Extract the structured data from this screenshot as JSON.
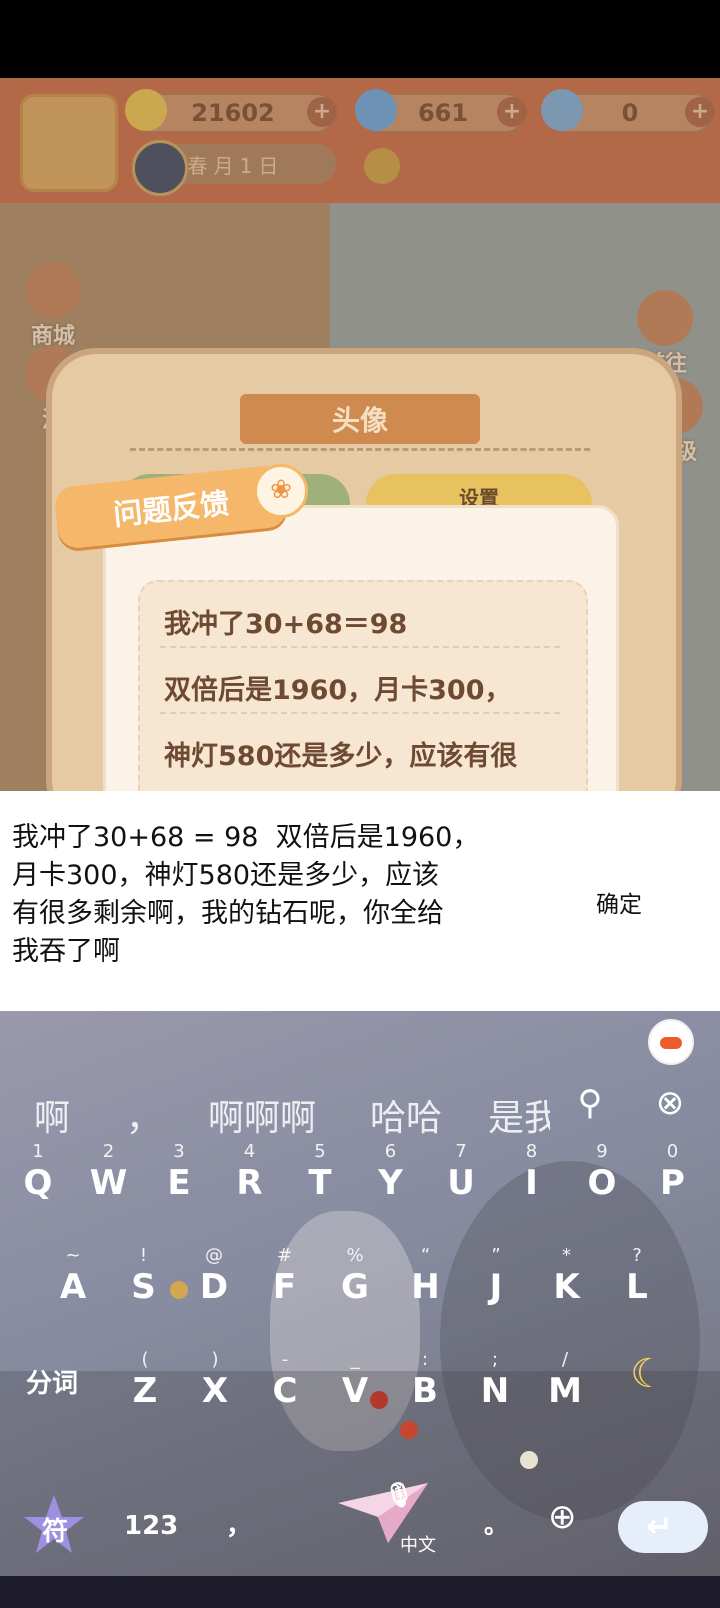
{
  "game": {
    "resources": [
      {
        "value": "21602",
        "icon": "banana-icon",
        "color": "#e8c04a"
      },
      {
        "value": "661",
        "icon": "flame-icon",
        "color": "#5aa0e6"
      },
      {
        "value": "0",
        "icon": "blue-banana-icon",
        "color": "#6ea8e0"
      }
    ],
    "date_label": "春月1日",
    "side_left": [
      "商城",
      "活"
    ],
    "side_right": [
      "前往",
      "等级"
    ],
    "panel_title": "头像",
    "tab_settings": "设置",
    "feedback_tag": "问题反馈",
    "feedback_lines": [
      "我冲了30+68＝98",
      "双倍后是1960，月卡300，",
      "神灯580还是多少，应该有很"
    ]
  },
  "edit": {
    "text": "我冲了30+68 = 98  双倍后是1960，\n月卡300，神灯580还是多少，应该\n有很多剩余啊，我的钻石呢，你全给\n我吞了啊",
    "confirm_label": "确定"
  },
  "keyboard": {
    "candidates": [
      "啊",
      "，",
      "啊啊啊",
      "哈哈",
      "是我"
    ],
    "row1": [
      {
        "num": "1",
        "ltr": "Q"
      },
      {
        "num": "2",
        "ltr": "W"
      },
      {
        "num": "3",
        "ltr": "E"
      },
      {
        "num": "4",
        "ltr": "R"
      },
      {
        "num": "5",
        "ltr": "T"
      },
      {
        "num": "6",
        "ltr": "Y"
      },
      {
        "num": "7",
        "ltr": "U"
      },
      {
        "num": "8",
        "ltr": "I"
      },
      {
        "num": "9",
        "ltr": "O"
      },
      {
        "num": "0",
        "ltr": "P"
      }
    ],
    "row2": [
      {
        "num": "~",
        "ltr": "A"
      },
      {
        "num": "!",
        "ltr": "S"
      },
      {
        "num": "@",
        "ltr": "D"
      },
      {
        "num": "#",
        "ltr": "F"
      },
      {
        "num": "%",
        "ltr": "G"
      },
      {
        "num": "“",
        "ltr": "H"
      },
      {
        "num": "”",
        "ltr": "J"
      },
      {
        "num": "*",
        "ltr": "K"
      },
      {
        "num": "?",
        "ltr": "L"
      }
    ],
    "row3": [
      {
        "num": "(",
        "ltr": "Z"
      },
      {
        "num": ")",
        "ltr": "X"
      },
      {
        "num": "-",
        "ltr": "C"
      },
      {
        "num": "_",
        "ltr": "V"
      },
      {
        "num": ":",
        "ltr": "B"
      },
      {
        "num": ";",
        "ltr": "N"
      },
      {
        "num": "/",
        "ltr": "M"
      }
    ],
    "segment_label": "分词",
    "symbol_label": "符",
    "num_label": "123",
    "comma_label": "，",
    "space_label": "中文",
    "period_label": "。"
  }
}
